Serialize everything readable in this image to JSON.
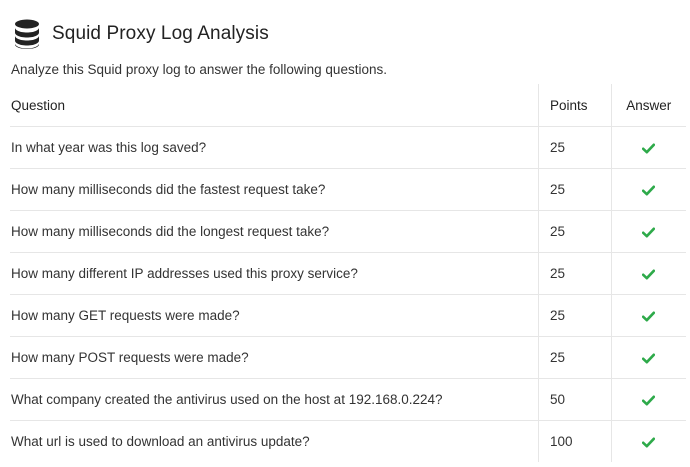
{
  "page": {
    "title": "Squid Proxy Log Analysis",
    "icon": "database-icon",
    "subtitle": "Analyze this Squid proxy log to answer the following questions."
  },
  "table": {
    "headers": {
      "question": "Question",
      "points": "Points",
      "answer": "Answer"
    },
    "rows": [
      {
        "question": "In what year was this log saved?",
        "points": "25",
        "answered": true
      },
      {
        "question": "How many milliseconds did the fastest request take?",
        "points": "25",
        "answered": true
      },
      {
        "question": "How many milliseconds did the longest request take?",
        "points": "25",
        "answered": true
      },
      {
        "question": "How many different IP addresses used this proxy service?",
        "points": "25",
        "answered": true
      },
      {
        "question": "How many GET requests were made?",
        "points": "25",
        "answered": true
      },
      {
        "question": "How many POST requests were made?",
        "points": "25",
        "answered": true
      },
      {
        "question": "What company created the antivirus used on the host at 192.168.0.224?",
        "points": "50",
        "answered": true
      },
      {
        "question": "What url is used to download an antivirus update?",
        "points": "100",
        "answered": true
      }
    ]
  },
  "colors": {
    "check": "#2eaa4a",
    "border": "#e6e6e6",
    "icon": "#222222"
  }
}
